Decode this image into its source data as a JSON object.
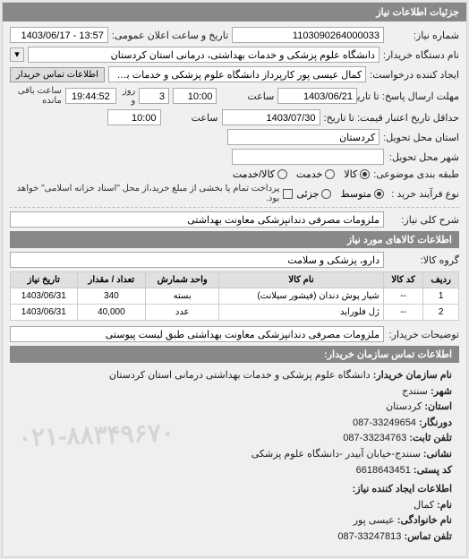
{
  "panel_title": "جزئیات اطلاعات نیاز",
  "fields": {
    "need_no_lbl": "شماره نیاز:",
    "need_no": "1103090264000033",
    "pub_dt_lbl": "تاریخ و ساعت اعلان عمومی:",
    "pub_dt": "13:57 - 1403/06/17",
    "buyer_org_lbl": "نام دستگاه خریدار:",
    "buyer_org": "دانشگاه علوم پزشکی و خدمات بهداشتی، درمانی استان کردستان",
    "requester_lbl": "ایجاد کننده درخواست:",
    "requester": "کمال عیسی پور کارپرداز دانشگاه علوم پزشکی و خدمات بهداشتی، درمانی اس",
    "contact_btn": "اطلاعات تماس خریدار",
    "deadline_send_lbl": "مهلت ارسال پاسخ: تا تاریخ:",
    "deadline_send_date": "1403/06/21",
    "deadline_send_time_lbl": "ساعت",
    "deadline_send_time": "10:00",
    "days_val": "3",
    "days_lbl": "روز و",
    "timer": "19:44:52",
    "timer_lbl": "ساعت باقی مانده",
    "valid_lbl": "حداقل تاریخ اعتبار قیمت: تا تاریخ:",
    "valid_date": "1403/07/30",
    "valid_time_lbl": "ساعت",
    "valid_time": "10:00",
    "province_lbl": "استان محل تحویل:",
    "province": "کردستان",
    "city_lbl": "شهر محل تحویل:",
    "city": "",
    "pkg_lbl": "طبقه بندی موضوعی:",
    "pkg_opts": {
      "a": "کالا",
      "b": "خدمت",
      "c": "کالا/خدمت"
    },
    "process_lbl": "نوع فرآیند خرید :",
    "process_opts": {
      "a": "متوسط",
      "b": "جزئی"
    },
    "process_note": "پرداخت تمام یا بخشی از مبلغ خرید،از محل \"اسناد خزانه اسلامی\" خواهد بود.",
    "desc_lbl": "شرح کلی نیاز:",
    "desc": "ملزومات مصرفی دندانپزشکی معاونت بهداشتی",
    "items_title": "اطلاعات کالاهای مورد نیاز",
    "group_lbl": "گروه کالا:",
    "group": "دارو، پزشکی و سلامت",
    "table": {
      "headers": [
        "ردیف",
        "کد کالا",
        "نام کالا",
        "واحد شمارش",
        "تعداد / مقدار",
        "تاریخ نیاز"
      ],
      "rows": [
        [
          "1",
          "--",
          "شیار پوش دندان (فیشور سیلانت)",
          "بسته",
          "340",
          "1403/06/31"
        ],
        [
          "2",
          "--",
          "ژل فلوراید",
          "عدد",
          "40,000",
          "1403/06/31"
        ]
      ]
    },
    "buyer_note_lbl": "توضیحات خریدار:",
    "buyer_note": "ملزومات مصرفی دندانپزشکی معاونت بهداشتی طبق لیست پیوستی",
    "contact_title": "اطلاعات تماس سازمان خریدار:",
    "contact": {
      "org_lbl": "نام سازمان خریدار:",
      "org": "دانشگاه علوم پزشکی و خدمات بهداشتی درمانی استان کردستان",
      "city_lbl": "شهر:",
      "city": "سنندج",
      "prov_lbl": "استان:",
      "prov": "کردستان",
      "fax_lbl": "دورنگار:",
      "fax": "33249654-087",
      "tel_lbl": "تلفن ثابت:",
      "tel": "33234763-087",
      "addr_lbl": "نشانی:",
      "addr": "سنندج-خیابان آبیدر -دانشگاه علوم پزشکی",
      "post_lbl": "کد پستی:",
      "post": "6618643451",
      "creator_title": "اطلاعات ایجاد کننده نیاز:",
      "fname_lbl": "نام:",
      "fname": "کمال",
      "lname_lbl": "نام خانوادگی:",
      "lname": "عیسی پور",
      "ctel_lbl": "تلفن تماس:",
      "ctel": "33247813-087"
    }
  },
  "watermark": "۰۲۱-۸۸۳۴۹۶۷۰"
}
